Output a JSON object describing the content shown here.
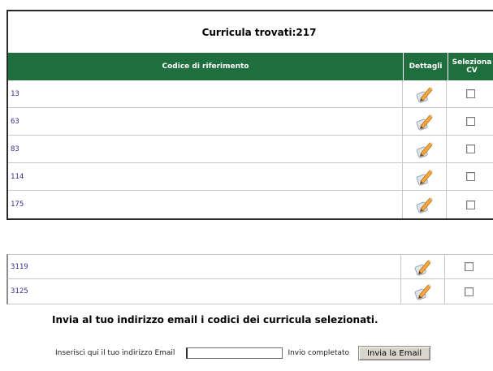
{
  "results": {
    "title": "Curricula trovati:217"
  },
  "table": {
    "columns": {
      "code": "Codice di riferimento",
      "details": "Dettagli",
      "select_line1": "Seleziona",
      "select_line2": "CV"
    },
    "rows_top": [
      {
        "code": "13"
      },
      {
        "code": "63"
      },
      {
        "code": "83"
      },
      {
        "code": "114"
      },
      {
        "code": "175"
      }
    ],
    "rows_bottom": [
      {
        "code": "3119"
      },
      {
        "code": "3125"
      }
    ]
  },
  "email": {
    "heading": "Invia al tuo indirizzo email i codici dei curricula selezionati.",
    "label": "Inserisci qui il tuo indirizzo Email",
    "input_value": "",
    "status": "Invio completato",
    "send_label": "Invia la Email"
  },
  "colors": {
    "header_green": "#1f6e3e",
    "link_purple": "#3c2e8c"
  },
  "icons": {
    "details": "pencil-icon",
    "select": "checkbox"
  }
}
